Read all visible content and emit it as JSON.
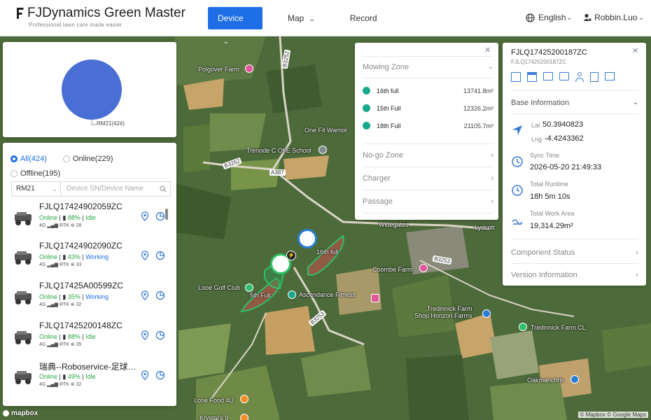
{
  "app": {
    "title": "FJDynamics Green Master",
    "tagline": "Professional lawn care made easier"
  },
  "nav": {
    "items": [
      {
        "label": "Device",
        "active": true
      },
      {
        "label": "Map",
        "active": false
      },
      {
        "label": "Record",
        "active": false
      }
    ]
  },
  "header": {
    "language": "English",
    "user": "Robbin.Luo"
  },
  "pie": {
    "label": "RM21(424)",
    "color": "#4a6fd4"
  },
  "filters": {
    "all": "All(424)",
    "online": "Online(229)",
    "offline": "Offline(195)",
    "model_select": "RM21",
    "search_placeholder": "Device SN/Device Name"
  },
  "devices": [
    {
      "name": "FJLQ17424902059ZC",
      "status": "Online",
      "battery": "88%",
      "state": "Idle",
      "state_color": "#28a745",
      "signal_4g": "4G",
      "rtk": "RTK",
      "sats": "28"
    },
    {
      "name": "FJLQ17424902090ZC",
      "status": "Online",
      "battery": "43%",
      "state": "Working",
      "state_color": "#1e6fe6",
      "signal_4g": "4G",
      "rtk": "RTK",
      "sats": "33"
    },
    {
      "name": "FJLQ17425A00599ZC",
      "status": "Online",
      "battery": "35%",
      "state": "Working",
      "state_color": "#1e6fe6",
      "signal_4g": "4G",
      "rtk": "RTK",
      "sats": "32"
    },
    {
      "name": "FJLQ17425200148ZC",
      "status": "Online",
      "battery": "88%",
      "state": "Idle",
      "state_color": "#28a745",
      "signal_4g": "4G",
      "rtk": "RTK",
      "sats": "35"
    },
    {
      "name": "瑞典--Roboservice-足球…",
      "status": "Online",
      "battery": "49%",
      "state": "Idle",
      "state_color": "#28a745",
      "signal_4g": "4G",
      "rtk": "RTK",
      "sats": "32"
    }
  ],
  "zones": {
    "mowing_zone": "Mowing Zone",
    "items": [
      {
        "name": "16th full",
        "area": "13741.8m²"
      },
      {
        "name": "15th Full",
        "area": "12326.2m²"
      },
      {
        "name": "18th Full",
        "area": "21105.7m²"
      }
    ],
    "nogo": "No-go Zone",
    "charger": "Charger",
    "passage": "Passage"
  },
  "info": {
    "sn": "FJLQ17425200187ZC",
    "sn_sub": "FJLQ17425200187ZC",
    "base_info": "Base Information",
    "lat_label": "Lat",
    "lat": "50.3940823",
    "lng_label": "Lng",
    "lng": "-4.4243362",
    "sync_label": "Sync Time",
    "sync": "2026-05-20 21:49:33",
    "runtime_label": "Total Runtime",
    "runtime": "18h 5m 10s",
    "workarea_label": "Total Work Area",
    "workarea": "19,314.29m²",
    "component_status": "Component Status",
    "version_info": "Version Information"
  },
  "map": {
    "labels": {
      "polgover": "Polgover Farm",
      "onefit": "One Fit Warrior",
      "trenode": "Trenode C Of E School",
      "widegates": "Widegates",
      "lydcott": "Lydcott",
      "coombe": "Coombe Farm",
      "looegolf": "Looe Golf Club",
      "ascendance": "Ascendance Fitness",
      "tredinnick": "Tredinnick Farm\nShop  Horizon Farms",
      "tredinnick_cl": "Tredinnick Farm CL",
      "oakmanchris": "Oakmanchris",
      "looefood": "Looe Food 4U",
      "krystals": "Krystal's 9",
      "sixteenth": "16th full",
      "fifth": "5th Full"
    },
    "roads": [
      "B3252",
      "B3252",
      "A387",
      "B3253",
      "B3253"
    ],
    "attribution": "© Mapbox © Google Maps",
    "mapbox": "mapbox"
  }
}
